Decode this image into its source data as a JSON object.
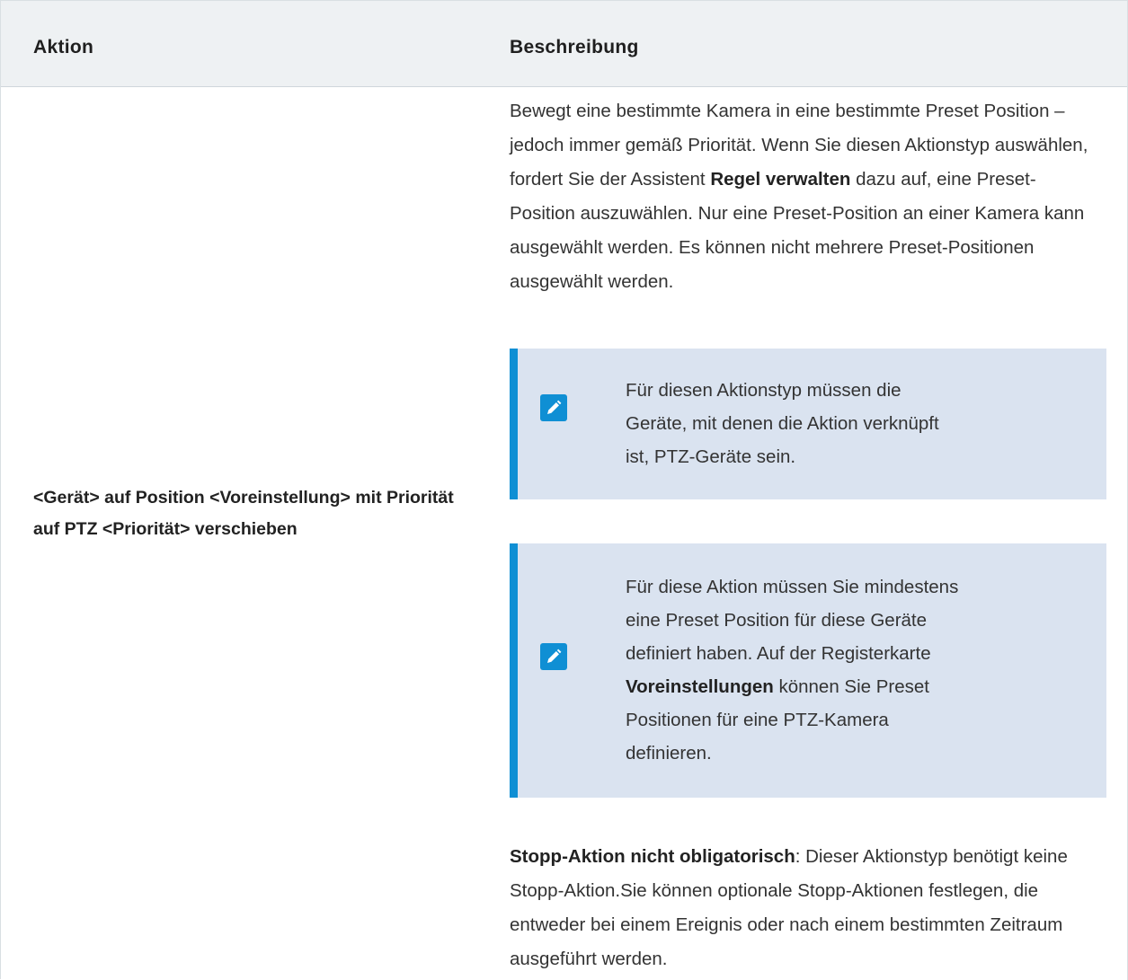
{
  "table": {
    "headers": {
      "action": "Aktion",
      "description": "Beschreibung"
    },
    "row": {
      "action": "<Gerät> auf Position <Voreinstellung> mit Priorität auf PTZ <Priorität> verschieben",
      "description_intro": {
        "p1": "Bewegt eine bestimmte Kamera in eine bestimmte Preset Position – jedoch immer gemäß Priorität. Wenn Sie diesen Aktionstyp auswählen, fordert Sie der Assistent ",
        "p1_bold": "Regel verwalten",
        "p1_rest": " dazu auf, eine Preset-Position auszuwählen. Nur eine Preset-Position an einer Kamera kann ausgewählt werden. Es können nicht mehrere Preset-Positionen ausgewählt werden."
      },
      "note1": {
        "icon": "edit-pencil-icon",
        "text": "Für diesen Aktionstyp müssen die Geräte, mit denen die Aktion verknüpft ist, PTZ-Geräte sein."
      },
      "note2": {
        "icon": "edit-pencil-icon",
        "text_before": "Für diese Aktion müssen Sie mindestens eine Preset Position für diese Geräte definiert haben. Auf der Registerkarte ",
        "text_bold": "Voreinstellungen",
        "text_after": " können Sie Preset Positionen für eine PTZ-Kamera definieren."
      },
      "stop": {
        "bold": "Stopp-Aktion nicht obligatorisch",
        "rest": ": Dieser Aktionstyp benötigt keine Stopp-Aktion.Sie können optionale Stopp-Aktionen festlegen, die entweder bei einem Ereignis oder nach einem bestimmten Zeitraum ausgeführt werden."
      }
    }
  },
  "colors": {
    "note_background": "#dae3f0",
    "note_accent": "#0f8fd4",
    "header_background": "#eef1f3"
  }
}
